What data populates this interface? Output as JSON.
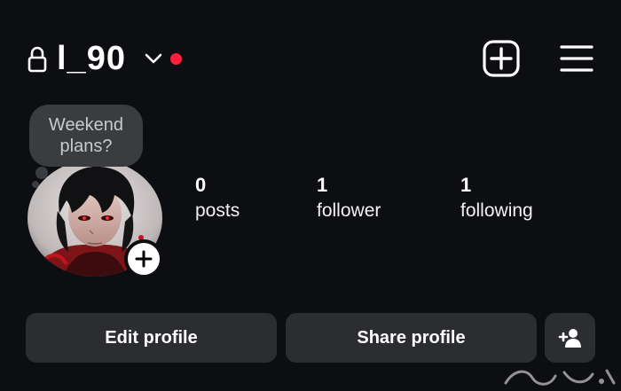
{
  "header": {
    "username": "l_90",
    "icons": [
      "lock-icon",
      "chevron-down-icon",
      "notification-dot",
      "create-post-icon",
      "menu-icon"
    ]
  },
  "note": {
    "line1": "Weekend",
    "line2": "plans?"
  },
  "stats": [
    {
      "value": "0",
      "label": "posts"
    },
    {
      "value": "1",
      "label": "follower"
    },
    {
      "value": "1",
      "label": "following"
    }
  ],
  "buttons": {
    "edit": "Edit profile",
    "share": "Share profile",
    "discover_icon": "add-person-icon"
  },
  "colors": {
    "background": "#0d0e11",
    "button": "#2b2d31",
    "notification": "#ff1f3d",
    "note_bubble": "#3b3c40"
  }
}
